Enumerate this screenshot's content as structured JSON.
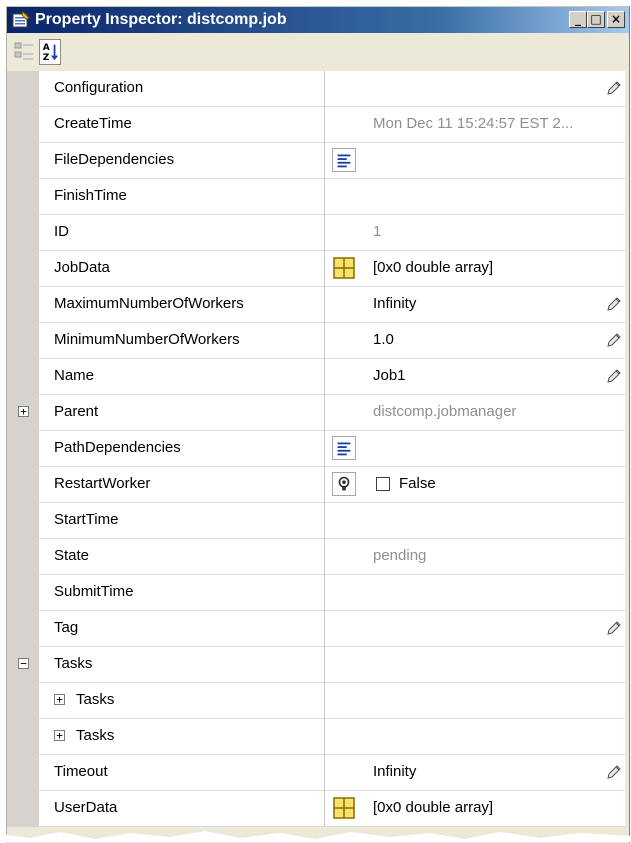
{
  "window": {
    "title": "Property Inspector:  distcomp.job"
  },
  "titlebar_buttons": {
    "minimize": "_",
    "maximize": "□",
    "close": "×"
  },
  "toolbar": {
    "categorized_icon": "categorized-view-icon",
    "sort_icon": "sort-alphabetical-icon"
  },
  "properties": [
    {
      "name": "Configuration",
      "value": "",
      "editable": true
    },
    {
      "name": "CreateTime",
      "value": "Mon Dec 11 15:24:57 EST 2...",
      "readonly": true
    },
    {
      "name": "FileDependencies",
      "value": "",
      "button": "list"
    },
    {
      "name": "FinishTime",
      "value": ""
    },
    {
      "name": "ID",
      "value": "1",
      "readonly": true
    },
    {
      "name": "JobData",
      "value": "[0x0  double array]",
      "button": "grid"
    },
    {
      "name": "MaximumNumberOfWorkers",
      "value": "Infinity",
      "editable": true
    },
    {
      "name": "MinimumNumberOfWorkers",
      "value": "1.0",
      "editable": true
    },
    {
      "name": "Name",
      "value": "Job1",
      "editable": true
    },
    {
      "name": "Parent",
      "value": "distcomp.jobmanager",
      "readonly": true,
      "expander": "+"
    },
    {
      "name": "PathDependencies",
      "value": "",
      "button": "list"
    },
    {
      "name": "RestartWorker",
      "value": "False",
      "button": "bulb",
      "checkbox": true
    },
    {
      "name": "StartTime",
      "value": ""
    },
    {
      "name": "State",
      "value": "pending",
      "readonly": true
    },
    {
      "name": "SubmitTime",
      "value": ""
    },
    {
      "name": "Tag",
      "value": "",
      "editable": true
    },
    {
      "name": "Tasks",
      "value": "",
      "expander": "−"
    },
    {
      "name": "Tasks",
      "value": "",
      "child": true
    },
    {
      "name": "Tasks",
      "value": "",
      "child": true
    },
    {
      "name": "Timeout",
      "value": "Infinity",
      "editable": true
    },
    {
      "name": "UserData",
      "value": "[0x0  double array]",
      "button": "grid"
    }
  ]
}
